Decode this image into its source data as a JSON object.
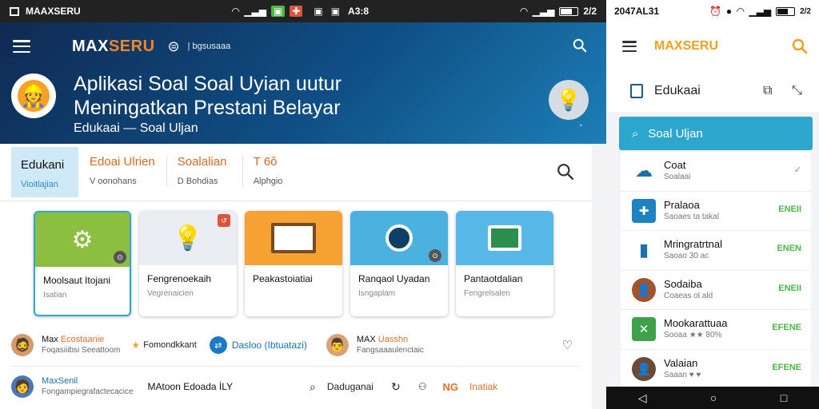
{
  "status_left": {
    "app": "MAAXSERU",
    "time": "A3:8"
  },
  "status_right": {
    "time": "2047AL31",
    "battery": "2/2"
  },
  "left_app": {
    "brand_prefix": "MAX",
    "brand_suffix": "SERU",
    "brand_sub": "| bgsusaaa",
    "title_line1": "Aplikasi Soal Soal Uyian uutur",
    "title_line2": "Meningatkan Prestani Belayar",
    "subtitle": "Edukaai — Soal Uljan",
    "tabs": [
      {
        "label": "Edukani",
        "sub": "Vioitlajian"
      },
      {
        "label": "Edoai Ulrien",
        "sub": "V oonohans"
      },
      {
        "label": "Soalalian",
        "sub": "D Bohdias"
      },
      {
        "label": "T 6ô",
        "sub": "Alphgio"
      }
    ],
    "cards": [
      {
        "title": "Moolsaut Itojani",
        "sub": "Isatian",
        "icon": "tools-icon",
        "color": "#8cbf3f"
      },
      {
        "title": "Fengrenoekaih",
        "sub": "Vegrenaicien",
        "icon": "lightbulb-icon",
        "color": "#e9eef3"
      },
      {
        "title": "Peakastoiatiai",
        "sub": "",
        "icon": "board-icon",
        "color": "#f5a233"
      },
      {
        "title": "Ranqaol Uyadan",
        "sub": "Isngaplam",
        "icon": "robot-icon",
        "color": "#4bb2e0"
      },
      {
        "title": "Pantaotdalian",
        "sub": "Fengrelsalen",
        "icon": "screen-icon",
        "color": "#57b7e6"
      }
    ],
    "row1": {
      "user1_a": "Max",
      "user1_a_hl": "Ecostaanie",
      "user1_b": "Foqasiiibsi Seeattoom",
      "award": "Fomondkkant",
      "link": "Dasloo (Ibtuatazi)",
      "user2_a": "MAX",
      "user2_a_hl": "Uasshn",
      "user2_b": "Fangsaaaulenctaic"
    },
    "row2": {
      "user_a": "MaxSenil",
      "user_b": "Fongampiegrafactecacice",
      "mid": "MAtoon Edoada İLY",
      "sub_text": "Daduganai",
      "ng": "NG",
      "ng2": "Inatiak"
    }
  },
  "right_app": {
    "brand_prefix": "MAX",
    "brand_suffix": "SERU",
    "section": "Edukaai",
    "search_bar": "Soal Uljan",
    "items": [
      {
        "title": "Coat",
        "sub": "Soalaai",
        "status": "✓",
        "color": "#1b6fa8",
        "icon": "cloud-icon"
      },
      {
        "title": "Pralaoa",
        "sub": "Saoaes ta takal",
        "status": "ENEII",
        "color": "#1f82c0",
        "icon": "puzzle-icon"
      },
      {
        "title": "Mringratrtnal",
        "sub": "Saoao 30 ac",
        "status": "ENEN",
        "color": "#1f70b3",
        "icon": "document-icon"
      },
      {
        "title": "Sodaiba",
        "sub": "Coaeas ol ald",
        "status": "ENEII",
        "color": "#a0552a",
        "icon": "person-icon"
      },
      {
        "title": "Mookarattuaa",
        "sub": "Sooaa ★★ 80%",
        "status": "EFENE",
        "color": "#3fa14a",
        "icon": "chart-icon"
      },
      {
        "title": "Valaian",
        "sub": "Saaan ♥ ♥",
        "status": "EFENE",
        "color": "#6b4a35",
        "icon": "person-icon"
      }
    ]
  }
}
